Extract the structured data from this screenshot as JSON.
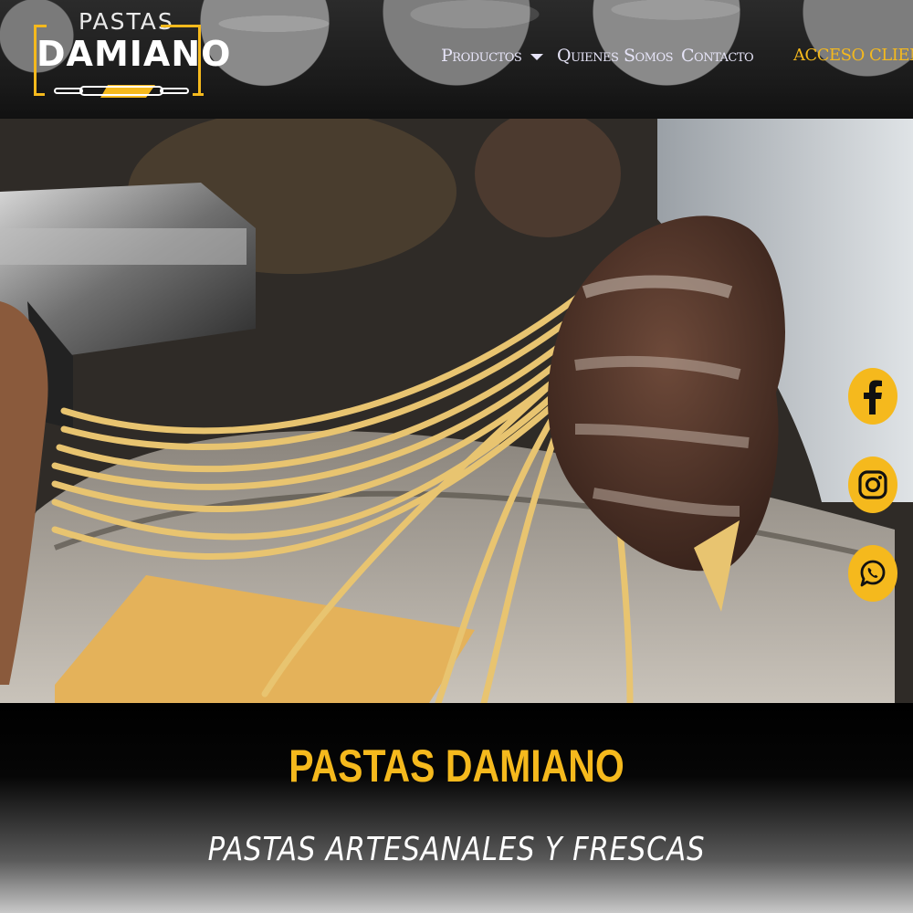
{
  "brand": {
    "logo_top": "PASTAS",
    "logo_main": "DAMIANO"
  },
  "nav": {
    "productos": "Productos",
    "quienes_somos": "Quienes Somos",
    "contacto": "Contacto",
    "acceso_clientes": "ACCESO CLIENTES"
  },
  "hero": {
    "image": "pasta-machine-fresh-noodles-photo"
  },
  "social": {
    "facebook": "facebook-icon",
    "instagram": "instagram-icon",
    "whatsapp": "whatsapp-icon"
  },
  "banner": {
    "title": "PASTAS DAMIANO",
    "subtitle": "PASTAS ARTESANALES Y FRESCAS"
  },
  "colors": {
    "accent": "#f5b91d",
    "nav_text": "#e6e4f7",
    "background": "#000000"
  }
}
